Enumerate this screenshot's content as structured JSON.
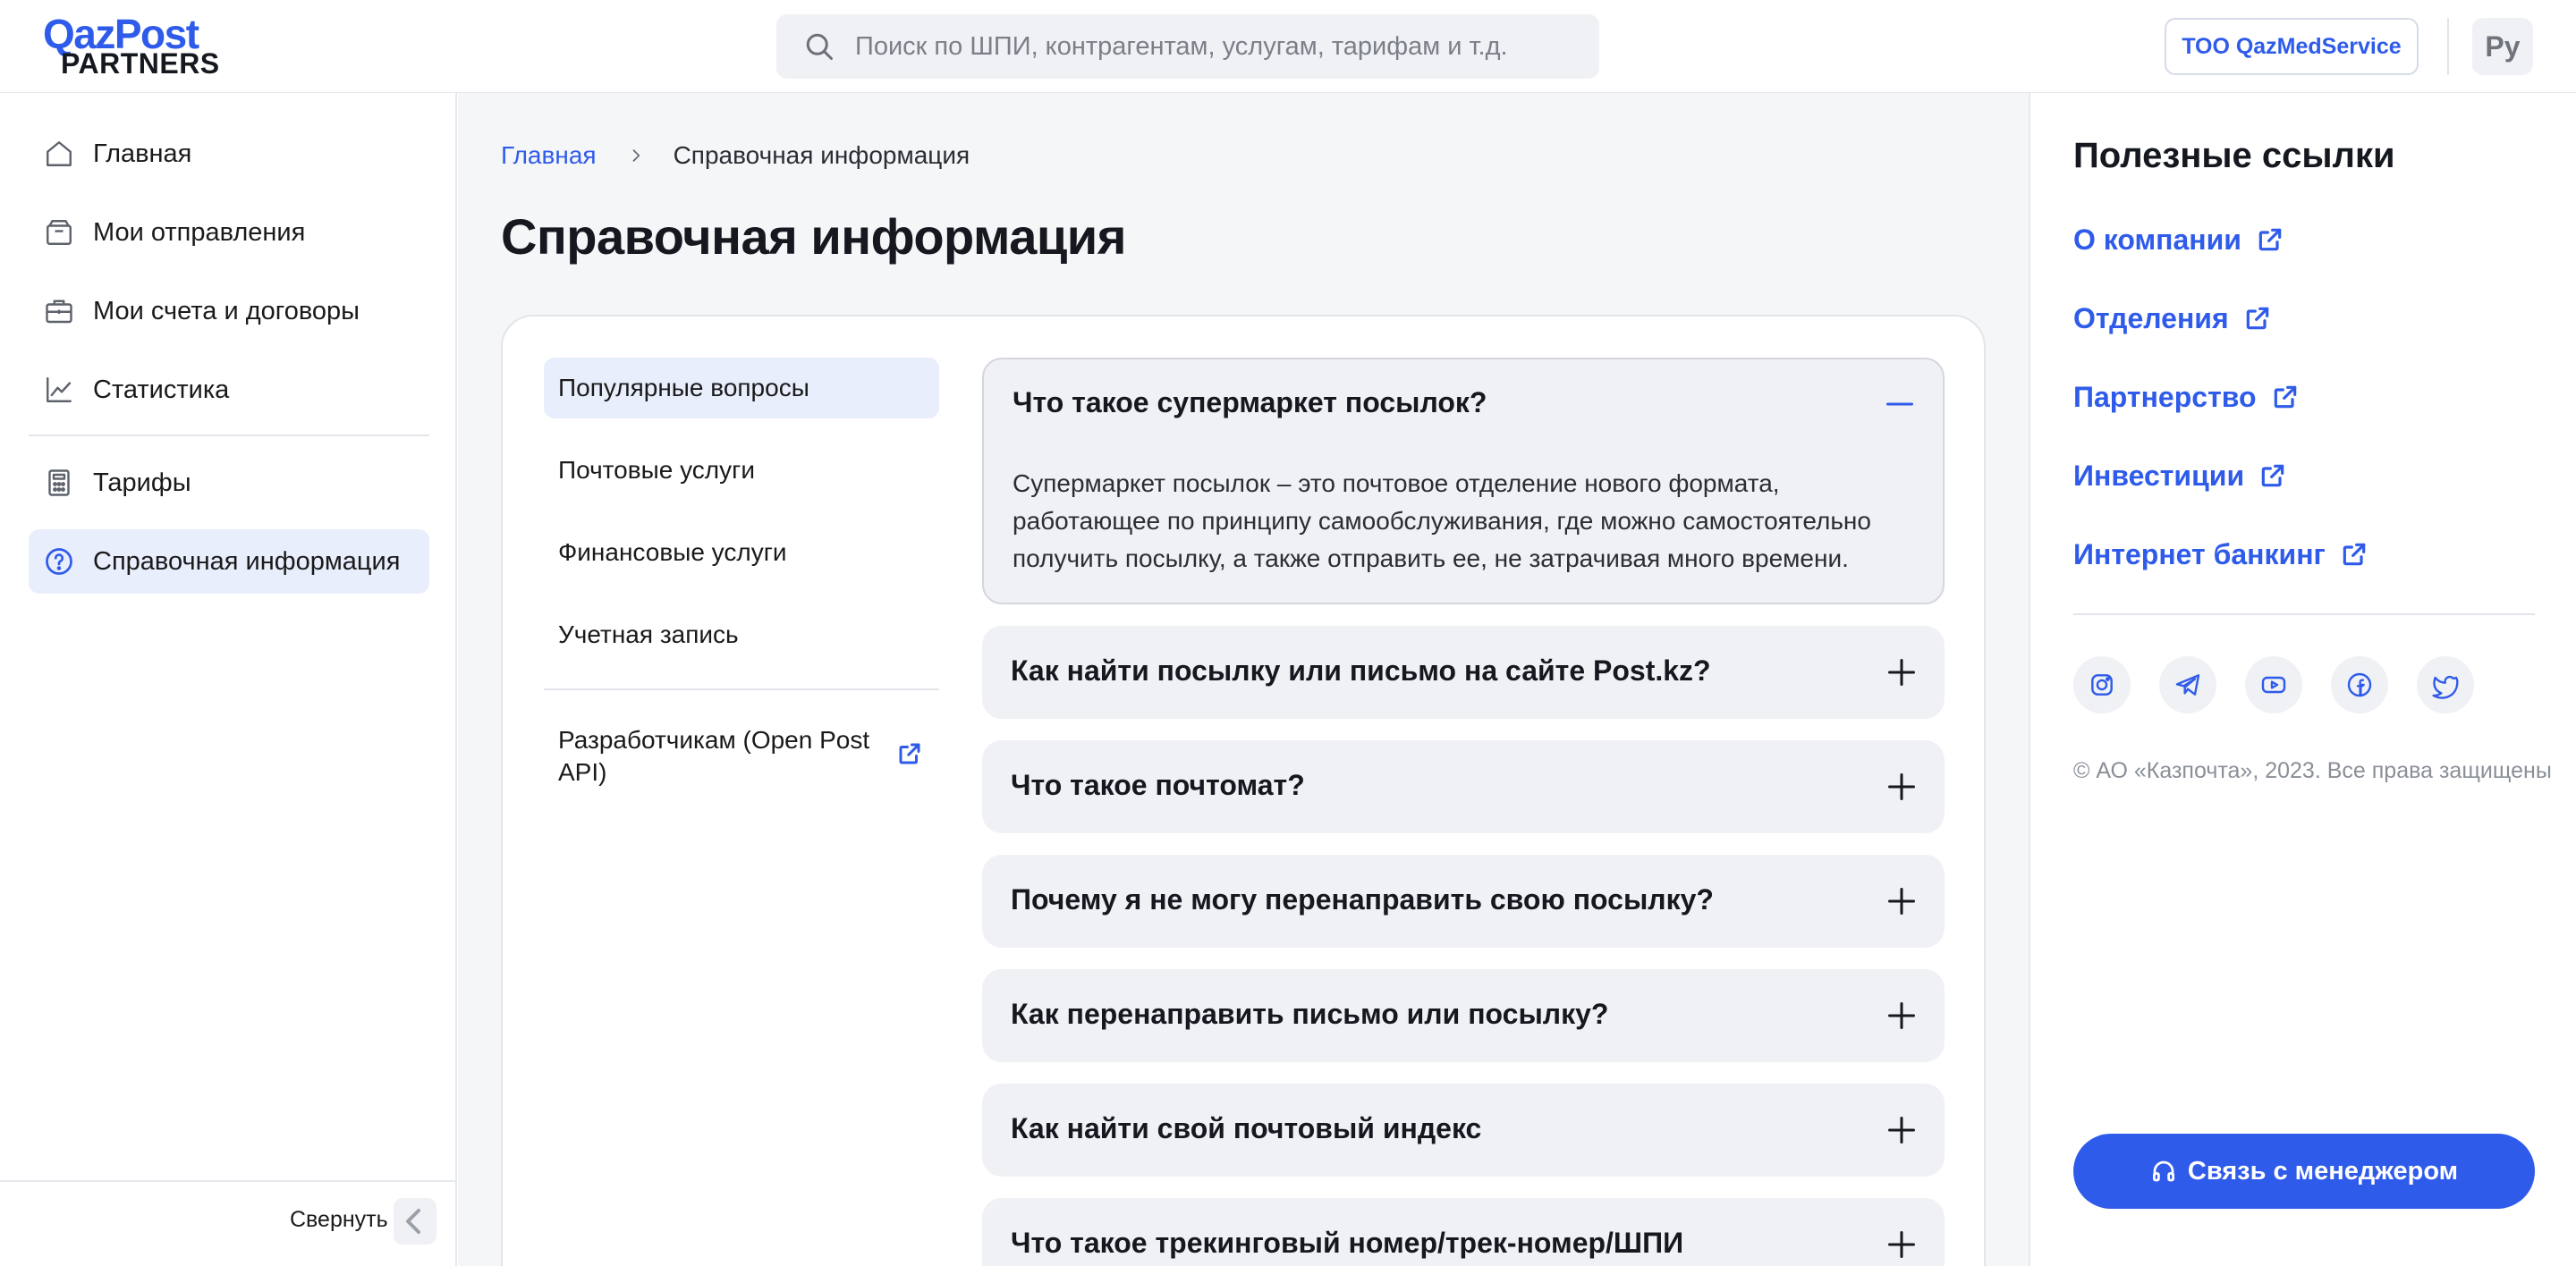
{
  "header": {
    "logo_top": "QazPost",
    "logo_bottom": "PARTNERS",
    "search_placeholder": "Поиск по ШПИ, контрагентам, услугам, тарифам и т.д.",
    "company_label": "ТОО QazMedService",
    "lang_label": "Ру"
  },
  "sidebar": {
    "items": [
      {
        "label": "Главная",
        "icon": "home-icon"
      },
      {
        "label": "Мои отправления",
        "icon": "box-icon"
      },
      {
        "label": "Мои счета и договоры",
        "icon": "briefcase-icon"
      },
      {
        "label": "Статистика",
        "icon": "chart-icon"
      },
      {
        "label": "Тарифы",
        "icon": "calculator-icon"
      },
      {
        "label": "Справочная информация",
        "icon": "help-icon",
        "active": true
      }
    ],
    "collapse_label": "Свернуть"
  },
  "main": {
    "breadcrumb": {
      "home": "Главная",
      "current": "Справочная информация"
    },
    "title": "Справочная информация",
    "categories": [
      {
        "label": "Популярные вопросы",
        "active": true
      },
      {
        "label": "Почтовые услуги"
      },
      {
        "label": "Финансовые услуги"
      },
      {
        "label": "Учетная запись"
      }
    ],
    "developer_link": "Разработчикам (Open Post API)",
    "faq": [
      {
        "question": "Что такое супермаркет посылок?",
        "open": true,
        "answer": "Супермаркет посылок – это почтовое отделение нового формата, работающее по принципу самообслуживания, где можно самостоятельно получить посылку, а также отправить ее, не затрачивая много времени."
      },
      {
        "question": "Как найти посылку или письмо на сайте Post.kz?"
      },
      {
        "question": "Что такое почтомат?"
      },
      {
        "question": "Почему я не могу перенаправить свою посылку?"
      },
      {
        "question": "Как перенаправить письмо или посылку?"
      },
      {
        "question": "Как найти свой почтовый индекс"
      },
      {
        "question": "Что такое трекинговый номер/трек-номер/ШПИ"
      }
    ]
  },
  "right_panel": {
    "title": "Полезные ссылки",
    "links": [
      "О компании",
      "Отделения",
      "Партнерство",
      "Инвестиции",
      "Интернет банкинг"
    ],
    "socials": [
      "instagram-icon",
      "telegram-icon",
      "youtube-icon",
      "facebook-icon",
      "twitter-icon"
    ],
    "copyright": "© АО «Казпочта», 2023. Все права защищены",
    "manager_button": "Связь с менеджером"
  },
  "colors": {
    "accent": "#2f5bea",
    "active_bg": "#e9eefc",
    "main_bg": "#f5f6f8",
    "faq_bg": "#f0f1f4"
  }
}
